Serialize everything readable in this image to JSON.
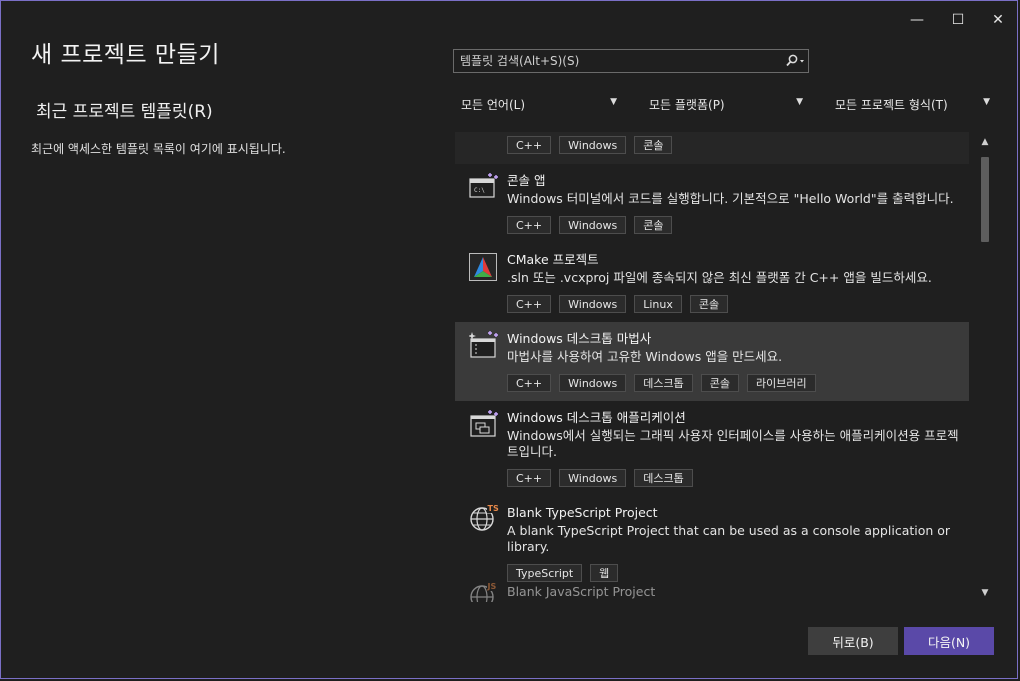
{
  "window": {
    "controls": {
      "minimize": "—",
      "maximize": "☐",
      "close": "✕"
    }
  },
  "page": {
    "title": "새 프로젝트 만들기",
    "recent_title": "최근 프로젝트 템플릿(R)",
    "recent_desc": "최근에 액세스한 템플릿 목록이 여기에 표시됩니다."
  },
  "search": {
    "placeholder": "템플릿 검색(Alt+S)(S)"
  },
  "filters": {
    "language": "모든 언어(L)",
    "platform": "모든 플랫폼(P)",
    "project_type": "모든 프로젝트 형식(T)"
  },
  "templates": [
    {
      "name": "",
      "desc": "",
      "tags": [
        "C++",
        "Windows",
        "콘솔"
      ]
    },
    {
      "name": "콘솔 앱",
      "desc": "Windows 터미널에서 코드를 실행합니다. 기본적으로 \"Hello World\"를 출력합니다.",
      "tags": [
        "C++",
        "Windows",
        "콘솔"
      ],
      "icon": "console-app-icon"
    },
    {
      "name": "CMake 프로젝트",
      "desc": ".sln 또는 .vcxproj 파일에 종속되지 않은 최신 플랫폼 간 C++ 앱을 빌드하세요.",
      "tags": [
        "C++",
        "Windows",
        "Linux",
        "콘솔"
      ],
      "icon": "cmake-icon"
    },
    {
      "name": "Windows 데스크톱 마법사",
      "desc": "마법사를 사용하여 고유한 Windows 앱을 만드세요.",
      "tags": [
        "C++",
        "Windows",
        "데스크톱",
        "콘솔",
        "라이브러리"
      ],
      "icon": "desktop-wizard-icon"
    },
    {
      "name": "Windows 데스크톱 애플리케이션",
      "desc": "Windows에서 실행되는 그래픽 사용자 인터페이스를 사용하는 애플리케이션용 프로젝트입니다.",
      "tags": [
        "C++",
        "Windows",
        "데스크톱"
      ],
      "icon": "desktop-app-icon"
    },
    {
      "name": "Blank TypeScript Project",
      "desc": "A blank TypeScript Project that can be used as a console application or library.",
      "tags": [
        "TypeScript",
        "웹"
      ],
      "icon": "typescript-globe-icon"
    },
    {
      "name": "Blank JavaScript Project",
      "desc": "",
      "tags": [],
      "icon": "javascript-globe-icon"
    }
  ],
  "icons": {
    "ts_badge": "TS",
    "js_badge": "JS",
    "console_glyph": "C:\\"
  },
  "buttons": {
    "back": "뒤로(B)",
    "next": "다음(N)"
  },
  "colors": {
    "accent": "#5a49a8",
    "window_border": "#7a6fc6",
    "selected_row": "#3a3a3a"
  }
}
